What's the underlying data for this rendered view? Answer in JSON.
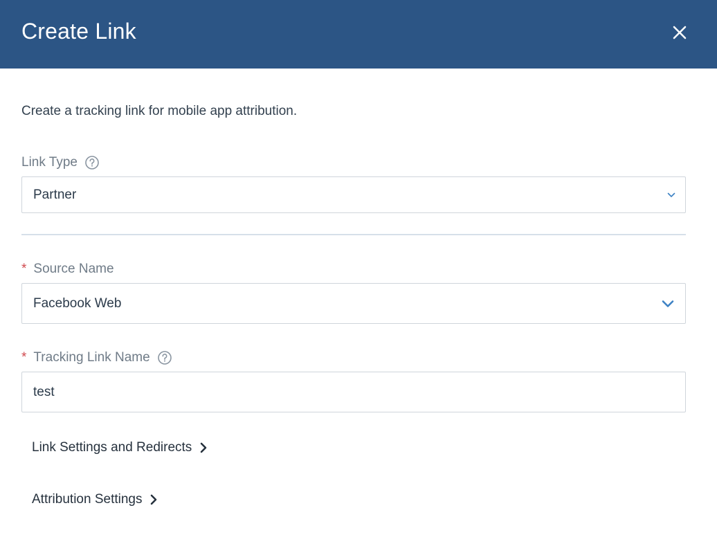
{
  "header": {
    "title": "Create Link"
  },
  "description": "Create a tracking link for mobile app attribution.",
  "link_type": {
    "label": "Link Type",
    "value": "Partner"
  },
  "source_name": {
    "required_mark": "*",
    "label": "Source Name",
    "value": "Facebook Web"
  },
  "tracking_link_name": {
    "required_mark": "*",
    "label": "Tracking Link Name",
    "value": "test"
  },
  "sections": {
    "link_settings": "Link Settings and Redirects",
    "attribution_settings": "Attribution Settings"
  },
  "icons": {
    "close": "close-icon",
    "help": "help-circle-icon",
    "chevron_down": "chevron-down-icon",
    "chevron_right": "chevron-right-icon"
  },
  "colors": {
    "header_bg": "#2c5585",
    "accent": "#3d82c4",
    "required": "#d0494e"
  }
}
